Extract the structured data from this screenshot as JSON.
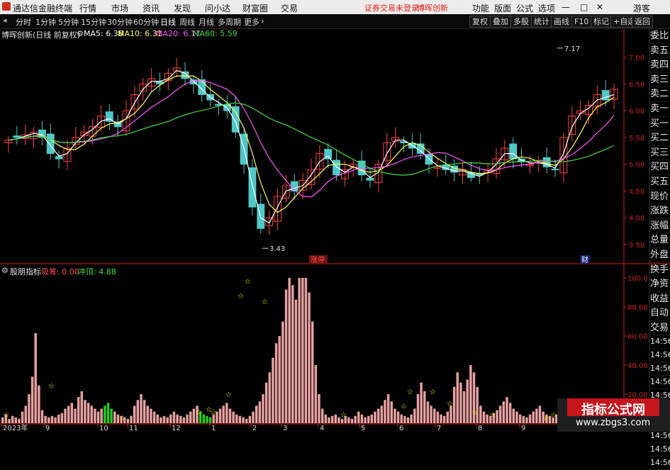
{
  "menubar": {
    "app_name": "通达信金融终端",
    "menus": [
      "行情",
      "市场",
      "资讯",
      "发现",
      "问小达",
      "财富圈",
      "交易"
    ],
    "warning": "证券交易未登录",
    "stock_name": "博晖创新",
    "right": [
      "功能",
      "版面",
      "公式",
      "选项"
    ],
    "guest": "游客"
  },
  "toolbar": {
    "periods": [
      "分时",
      "1分钟",
      "5分钟",
      "15分钟",
      "30分钟",
      "60分钟",
      "日线",
      "周线",
      "月线",
      "多周期",
      "更多"
    ],
    "active_period": "日线",
    "buttons": [
      "复权",
      "叠加",
      "多股",
      "统计",
      "画线",
      "F10",
      "标记",
      "+自选",
      "返回"
    ]
  },
  "legend": {
    "title": "博晖创新(日线 前复权)",
    "ma5": "MA5: 6.36",
    "ma10": "MA10: 6.31",
    "ma20": "MA20: 6.17",
    "ma60": "MA60: 5.59"
  },
  "price_axis": [
    "7.00",
    "6.50",
    "6.00",
    "5.50",
    "5.00",
    "4.50",
    "4.00",
    "3.50"
  ],
  "price_high": "7.17",
  "price_low": "3.43",
  "markers": {
    "limit_up": "涨停",
    "fin": "财"
  },
  "right_panel": [
    "委比",
    "卖五",
    "卖四",
    "卖三",
    "卖二",
    "卖一",
    "买一",
    "买二",
    "买三",
    "买四",
    "买五",
    "现价",
    "涨跌",
    "涨幅",
    "总量",
    "外盘",
    "换手",
    "净资",
    "收益",
    "自动",
    "交易",
    "14:56",
    "14:56",
    "14:56",
    "14:56",
    "14:56",
    "14:56",
    "14:56",
    "14:56",
    "14:56",
    "14:56"
  ],
  "indicator": {
    "name": "股朋指标",
    "chou": "吸筹: 0.00",
    "chong": "冲顶: 4.88",
    "axis": [
      "100.0",
      "80.00",
      "60.00",
      "40.00",
      "20.00"
    ]
  },
  "date_axis": [
    "2023年",
    "9",
    "10",
    "11",
    "12",
    "1",
    "2",
    "3",
    "4",
    "5",
    "6",
    "7",
    "8",
    "9"
  ],
  "watermark": {
    "t1": "指标公式网",
    "t2": "www.zbgs3.com"
  },
  "colors": {
    "up": "#ff4040",
    "down": "#50c8c8",
    "ma5": "#ffffff",
    "ma10": "#ffff55",
    "ma20": "#ff55ff",
    "ma60": "#44dd44",
    "bar": "#e8a0a0",
    "green_bar": "#22cc22",
    "star": "#ffff00",
    "axis": "#d02020"
  },
  "chart_data": {
    "type": "candlestick",
    "price_ylim": [
      3.3,
      7.3
    ],
    "indicator_ylim": [
      0,
      100
    ],
    "closes": [
      5.45,
      5.5,
      5.55,
      5.6,
      5.5,
      5.2,
      5.1,
      5.3,
      5.5,
      5.6,
      5.7,
      5.9,
      5.8,
      5.7,
      6.0,
      6.3,
      6.5,
      6.6,
      6.5,
      6.7,
      6.8,
      6.6,
      6.5,
      6.3,
      6.2,
      6.1,
      6.0,
      5.6,
      5.0,
      4.2,
      3.8,
      4.0,
      4.4,
      4.6,
      4.5,
      4.7,
      4.9,
      5.2,
      5.1,
      4.8,
      4.9,
      5.0,
      4.8,
      4.7,
      5.0,
      5.4,
      5.5,
      5.4,
      5.3,
      5.2,
      5.0,
      4.95,
      4.9,
      4.85,
      4.9,
      4.75,
      4.8,
      4.9,
      5.1,
      5.3,
      5.1,
      5.05,
      5.0,
      5.05,
      4.95,
      4.9,
      5.5,
      5.9,
      6.0,
      6.1,
      6.3,
      6.2,
      6.4
    ],
    "indicator_values": [
      4,
      6,
      3,
      5,
      4,
      3,
      8,
      12,
      20,
      32,
      62,
      26,
      9,
      5,
      4,
      5,
      4,
      6,
      7,
      10,
      12,
      14,
      10,
      18,
      22,
      16,
      14,
      12,
      10,
      8,
      10,
      12,
      14,
      10,
      8,
      6,
      5,
      4,
      3,
      5,
      12,
      16,
      20,
      16,
      12,
      10,
      8,
      6,
      4,
      5,
      4,
      6,
      8,
      6,
      5,
      4,
      6,
      8,
      10,
      12,
      8,
      6,
      5,
      4,
      6,
      8,
      10,
      12,
      14,
      10,
      8,
      6,
      5,
      4,
      3,
      5,
      8,
      12,
      15,
      20,
      28,
      35,
      45,
      55,
      60,
      70,
      92,
      100,
      95,
      85,
      100,
      100,
      100,
      90,
      70,
      40,
      20,
      10,
      6,
      4,
      5,
      6,
      4,
      3,
      5,
      4,
      3,
      5,
      8,
      6,
      4,
      5,
      6,
      8,
      10,
      12,
      16,
      20,
      15,
      10,
      8,
      6,
      5,
      4,
      6,
      10,
      20,
      28,
      22,
      15,
      12,
      10,
      8,
      6,
      5,
      8,
      12,
      25,
      35,
      28,
      22,
      30,
      40,
      35,
      25,
      12,
      8,
      6,
      5,
      7,
      9,
      12,
      15,
      18,
      14,
      10,
      8,
      6,
      5,
      4,
      6,
      8,
      10,
      12,
      8,
      6,
      5,
      4,
      6,
      5,
      4,
      3,
      5,
      6,
      7,
      5,
      4,
      3,
      5,
      8,
      12,
      15,
      10,
      8,
      6,
      5,
      4,
      3
    ]
  }
}
